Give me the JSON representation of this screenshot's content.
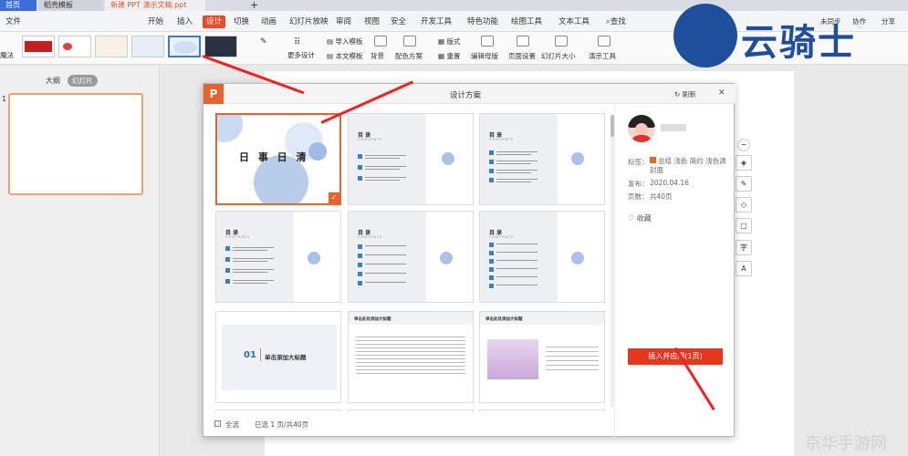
{
  "tabs": {
    "home": "首页",
    "template": "稻壳模板",
    "doc": "新建 PPT 演示文稿.ppt",
    "add": "+"
  },
  "menubar": {
    "file": "文件",
    "items": [
      "开始",
      "插入",
      "设计",
      "切换",
      "动画",
      "幻灯片放映",
      "审阅",
      "视图",
      "安全",
      "开发工具",
      "特色功能",
      "绘图工具",
      "文本工具"
    ],
    "active": "设计",
    "search": "查找",
    "right": [
      "未同步",
      "协作",
      "分享"
    ]
  },
  "ribbon": {
    "left_cut": "魔法",
    "more": "更多设计",
    "import": "导入模板",
    "textbox": "本文模板",
    "background": "背景",
    "color_scheme": "配色方案",
    "layout": "版式",
    "reset": "重置",
    "edit_master": "编辑母版",
    "page_setup": "页面设置",
    "slide_size": "幻灯片大小",
    "present_tools": "演示工具"
  },
  "leftpane": {
    "outline": "大纲",
    "slides": "幻灯片",
    "slide_num": "1"
  },
  "dialog": {
    "title": "设计方案",
    "refresh": "刷新",
    "close": "✕",
    "logo": "P",
    "card1_title": "日 事 日 清",
    "card_toc": "目 录",
    "card_contents": "CONTENTS",
    "card7_num": "01",
    "card7_title": "单击添加大标题",
    "card8_title": "单击此处添加大标题",
    "card9_title": "单击此处添加大标题",
    "footer_all": "全选",
    "footer_selected": "已选 1 页/共40页"
  },
  "info": {
    "tag_label": "标签：",
    "tags": "总结 浅色 简约 浅色调封面",
    "publish_label": "发布：",
    "publish_date": "2020.04.16",
    "pages_label": "页数：",
    "pages": "共40页",
    "favorite": "收藏",
    "apply_button": "插入并应用(1页)"
  },
  "tools": [
    "−",
    "◈",
    "✎",
    "◇",
    "▢",
    "字",
    "A"
  ],
  "watermark": {
    "logo": "云骑士",
    "footer": "京华手游网"
  }
}
